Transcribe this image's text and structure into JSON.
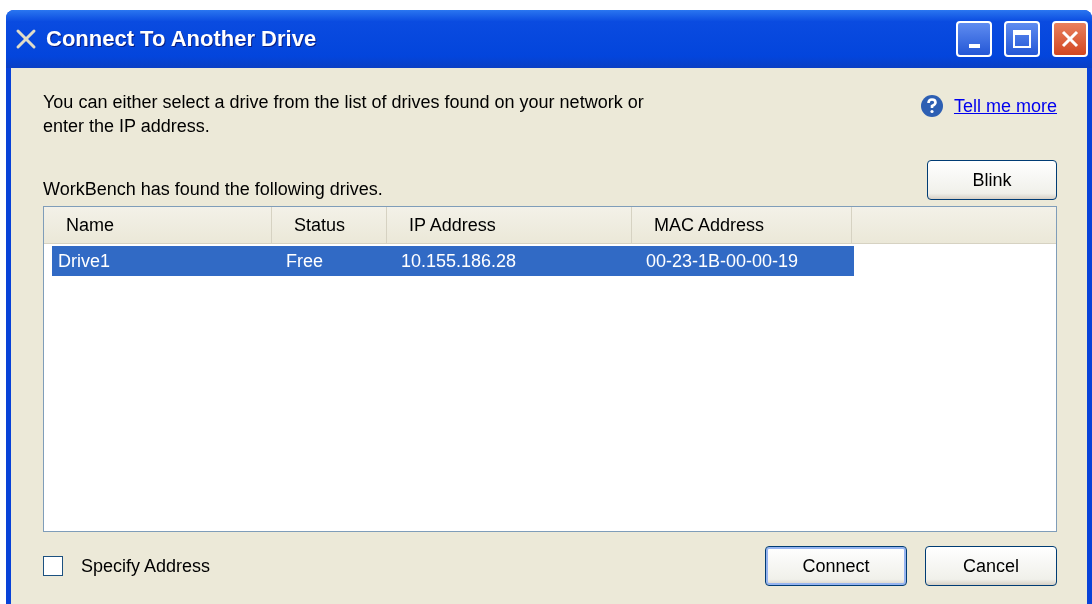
{
  "window": {
    "title": "Connect To Another Drive"
  },
  "intro": "You can either select a drive from the list of drives found on your network or enter the IP address.",
  "help_link": "Tell me more",
  "blink_button": "Blink",
  "list_caption": "WorkBench has found the following drives.",
  "table": {
    "columns": [
      "Name",
      "Status",
      "IP Address",
      "MAC Address"
    ],
    "rows": [
      {
        "cells": [
          "Drive1",
          "Free",
          "10.155.186.28",
          "00-23-1B-00-00-19"
        ],
        "selected": true
      }
    ]
  },
  "specify_address": {
    "label": "Specify Address",
    "checked": false
  },
  "buttons": [
    {
      "label": "Connect",
      "default": true
    },
    {
      "label": "Cancel",
      "default": false
    }
  ]
}
